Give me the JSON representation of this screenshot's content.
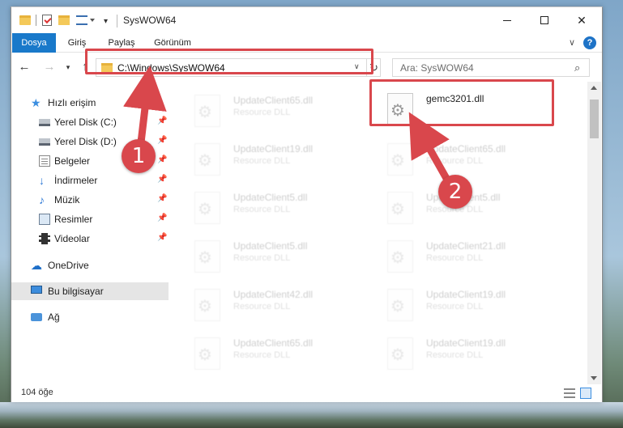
{
  "window": {
    "title": "SysWOW64"
  },
  "ribbon": {
    "tabs": [
      {
        "label": "Dosya"
      },
      {
        "label": "Giriş"
      },
      {
        "label": "Paylaş"
      },
      {
        "label": "Görünüm"
      }
    ],
    "help_glyph": "?"
  },
  "toolbar": {
    "back_glyph": "←",
    "forward_glyph": "→",
    "recent_glyph": "▾",
    "up_glyph": "↑",
    "refresh_glyph": "↻"
  },
  "address": {
    "path": "C:\\Windows\\SysWOW64"
  },
  "search": {
    "placeholder": "Ara: SysWOW64"
  },
  "sidebar": {
    "items": [
      {
        "label": "Hızlı erişim",
        "icon": "star-icon"
      },
      {
        "label": "Yerel Disk (C:)",
        "icon": "disk-icon",
        "pinned": true
      },
      {
        "label": "Yerel Disk (D:)",
        "icon": "disk-icon",
        "pinned": true
      },
      {
        "label": "Belgeler",
        "icon": "documents-icon",
        "pinned": true
      },
      {
        "label": "İndirmeler",
        "icon": "download-icon",
        "pinned": true
      },
      {
        "label": "Müzik",
        "icon": "music-icon",
        "pinned": true
      },
      {
        "label": "Resimler",
        "icon": "pictures-icon",
        "pinned": true
      },
      {
        "label": "Videolar",
        "icon": "videos-icon",
        "pinned": true
      },
      {
        "label": "OneDrive",
        "icon": "cloud-icon"
      },
      {
        "label": "Bu bilgisayar",
        "icon": "computer-icon",
        "selected": true
      },
      {
        "label": "Ağ",
        "icon": "network-icon"
      }
    ]
  },
  "files": [
    {
      "name": "UpdateClient65.dll",
      "type": "Resource DLL"
    },
    {
      "name": "gemc3201.dll",
      "type": ""
    },
    {
      "name": "UpdateClient19.dll",
      "type": "Resource DLL"
    },
    {
      "name": "UpdateClient65.dll",
      "type": "Resource DLL"
    },
    {
      "name": "UpdateClient5.dll",
      "type": "Resource DLL"
    },
    {
      "name": "UpdateClient5.dll",
      "type": "Resource DLL"
    },
    {
      "name": "UpdateClient5.dll",
      "type": "Resource DLL"
    },
    {
      "name": "UpdateClient21.dll",
      "type": "Resource DLL"
    },
    {
      "name": "UpdateClient42.dll",
      "type": "Resource DLL"
    },
    {
      "name": "UpdateClient19.dll",
      "type": "Resource DLL"
    },
    {
      "name": "UpdateClient65.dll",
      "type": "Resource DLL"
    },
    {
      "name": "UpdateClient19.dll",
      "type": "Resource DLL"
    }
  ],
  "status": {
    "item_count": "104 öğe"
  },
  "annotations": {
    "step1": "1",
    "step2": "2"
  },
  "colors": {
    "accent": "#1979ca",
    "highlight": "#d9474c"
  }
}
